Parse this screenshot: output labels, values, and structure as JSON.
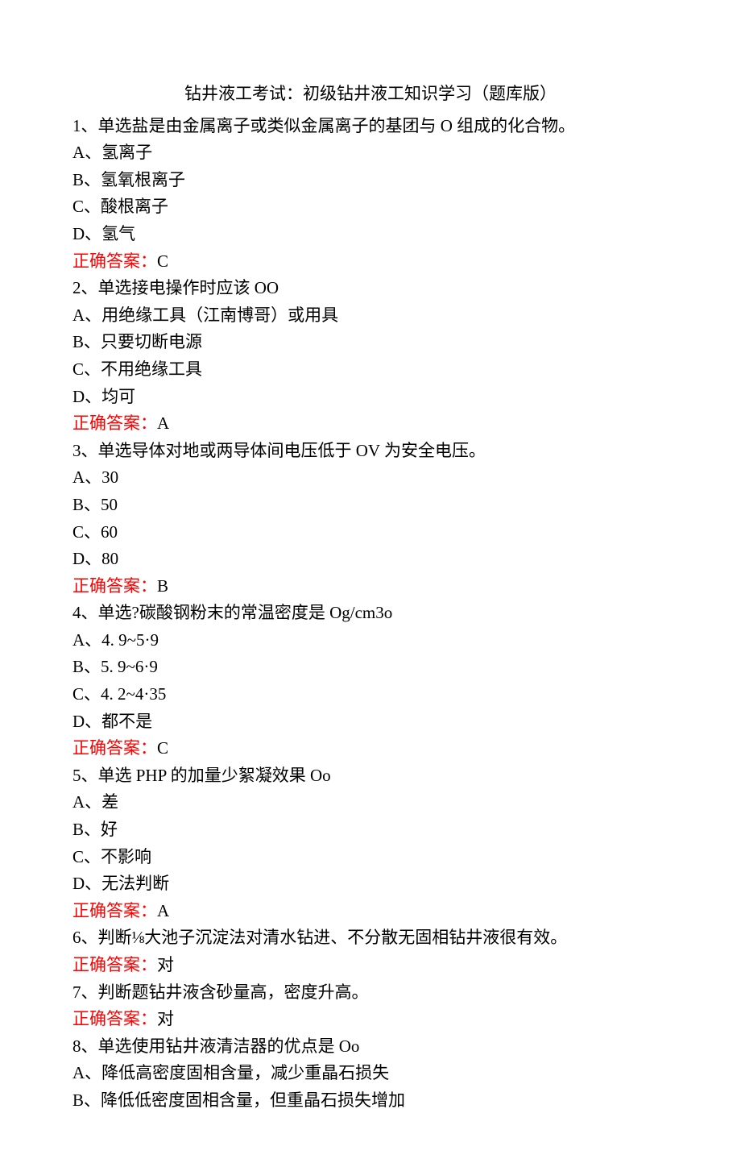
{
  "title": "钻井液工考试：初级钻井液工知识学习（题库版）",
  "answer_label": "正确答案：",
  "items": [
    {
      "question": "1、单选盐是由金属离子或类似金属离子的基团与 O 组成的化合物。",
      "options": [
        "A、氢离子",
        "B、氢氧根离子",
        "C、酸根离子",
        "D、氢气"
      ],
      "answer": "C"
    },
    {
      "question": "2、单选接电操作时应该 OO",
      "options": [
        "A、用绝缘工具（江南博哥）或用具",
        "B、只要切断电源",
        "C、不用绝缘工具",
        "D、均可"
      ],
      "answer": "A"
    },
    {
      "question": "3、单选导体对地或两导体间电压低于 OV 为安全电压。",
      "options": [
        "A、30",
        "B、50",
        "C、60",
        "D、80"
      ],
      "answer": "B"
    },
    {
      "question": "4、单选?碳酸钢粉末的常温密度是 Og/cm3o",
      "options": [
        "A、4. 9~5·9",
        "B、5. 9~6·9",
        "C、4. 2~4·35",
        "D、都不是"
      ],
      "answer": "C"
    },
    {
      "question": "5、单选 PHP 的加量少絮凝效果 Oo",
      "options": [
        "A、差",
        "B、好",
        "C、不影响",
        "D、无法判断"
      ],
      "answer": "A"
    },
    {
      "question": "6、判断⅛大池子沉淀法对清水钻进、不分散无固相钻井液很有效。",
      "options": [],
      "answer": "对"
    },
    {
      "question": "7、判断题钻井液含砂量高，密度升高。",
      "options": [],
      "answer": "对"
    },
    {
      "question": "8、单选使用钻井液清洁器的优点是 Oo",
      "options": [
        "A、降低高密度固相含量，减少重晶石损失",
        "B、降低低密度固相含量，但重晶石损失增加"
      ],
      "answer": null
    }
  ]
}
